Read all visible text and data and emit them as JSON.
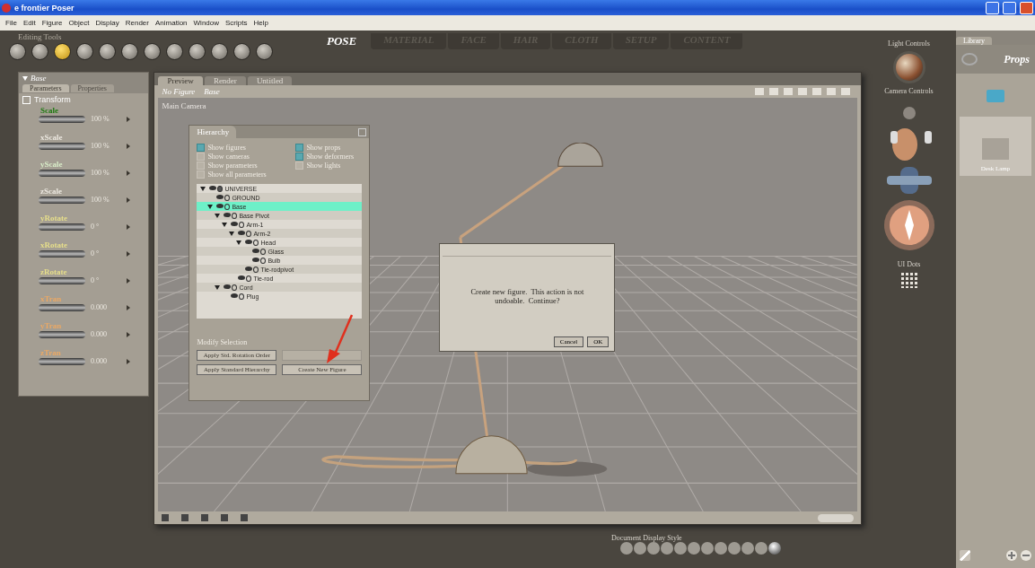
{
  "window": {
    "title": "e frontier Poser"
  },
  "menu": [
    "File",
    "Edit",
    "Figure",
    "Object",
    "Display",
    "Render",
    "Animation",
    "Window",
    "Scripts",
    "Help"
  ],
  "editing_tools": {
    "label": "Editing Tools",
    "tools": [
      {
        "selected": false
      },
      {
        "selected": false
      },
      {
        "selected": true
      },
      {
        "selected": false
      },
      {
        "selected": false
      },
      {
        "selected": false
      },
      {
        "selected": false
      },
      {
        "selected": false
      },
      {
        "selected": false
      },
      {
        "selected": false
      },
      {
        "selected": false
      },
      {
        "selected": false
      }
    ]
  },
  "rooms": [
    {
      "label": "POSE",
      "selected": true
    },
    {
      "label": "MATERIAL",
      "selected": false
    },
    {
      "label": "FACE",
      "selected": false
    },
    {
      "label": "HAIR",
      "selected": false
    },
    {
      "label": "CLOTH",
      "selected": false
    },
    {
      "label": "SETUP",
      "selected": false
    },
    {
      "label": "CONTENT",
      "selected": false
    }
  ],
  "parameters_panel": {
    "title": "Base",
    "tabs": [
      {
        "label": "Parameters",
        "selected": true
      },
      {
        "label": "Properties",
        "selected": false
      }
    ],
    "group": "Transform",
    "params": [
      {
        "name": "Scale",
        "value": "100 %",
        "color": "#1f7a12"
      },
      {
        "name": "xScale",
        "value": "100 %",
        "color": "#ece8e0"
      },
      {
        "name": "yScale",
        "value": "100 %",
        "color": "#d8ecc8"
      },
      {
        "name": "zScale",
        "value": "100 %",
        "color": "#ece8e0"
      },
      {
        "name": "yRotate",
        "value": "0 °",
        "color": "#e6de8a"
      },
      {
        "name": "xRotate",
        "value": "0 °",
        "color": "#e6de8a"
      },
      {
        "name": "zRotate",
        "value": "0 °",
        "color": "#e6de8a"
      },
      {
        "name": "xTran",
        "value": "0.000",
        "color": "#eaa865"
      },
      {
        "name": "yTran",
        "value": "0.000",
        "color": "#eaa865"
      },
      {
        "name": "zTran",
        "value": "0.000",
        "color": "#eaa865"
      }
    ]
  },
  "document": {
    "tabs": [
      {
        "label": "Preview",
        "selected": true
      },
      {
        "label": "Render",
        "selected": false
      },
      {
        "label": "Untitled",
        "selected": false
      }
    ],
    "figure_menu": "No Figure",
    "actor_menu": "Base",
    "camera": "Main Camera"
  },
  "hierarchy": {
    "title": "Hierarchy",
    "options": [
      {
        "label": "Show figures",
        "checked": true
      },
      {
        "label": "Show props",
        "checked": true
      },
      {
        "label": "Show cameras",
        "checked": false
      },
      {
        "label": "Show deformers",
        "checked": true
      },
      {
        "label": "Show parameters",
        "checked": false
      },
      {
        "label": "Show lights",
        "checked": false
      },
      {
        "label": "Show all parameters",
        "checked": false
      }
    ],
    "tree": [
      {
        "label": "UNIVERSE",
        "kind": "universe",
        "expanded": true,
        "selected": false,
        "children": [
          {
            "label": "GROUND",
            "kind": "prop",
            "selected": false
          },
          {
            "label": "Base",
            "kind": "prop",
            "expanded": true,
            "selected": true,
            "children": [
              {
                "label": "Base Pivot",
                "kind": "prop",
                "expanded": true,
                "selected": false,
                "children": [
                  {
                    "label": "Arm-1",
                    "kind": "prop",
                    "expanded": true,
                    "selected": false,
                    "children": [
                      {
                        "label": "Arm-2",
                        "kind": "prop",
                        "expanded": true,
                        "selected": false,
                        "children": [
                          {
                            "label": "Head",
                            "kind": "prop",
                            "expanded": true,
                            "selected": false,
                            "children": [
                              {
                                "label": "Glass",
                                "kind": "prop",
                                "selected": false
                              },
                              {
                                "label": "Bulb",
                                "kind": "prop",
                                "selected": false
                              }
                            ]
                          },
                          {
                            "label": "Tie-rodpivot",
                            "kind": "prop",
                            "selected": false
                          }
                        ]
                      },
                      {
                        "label": "Tie-rod",
                        "kind": "prop",
                        "selected": false
                      }
                    ]
                  }
                ]
              },
              {
                "label": "Cord",
                "kind": "prop",
                "expanded": true,
                "selected": false,
                "children": [
                  {
                    "label": "Plug",
                    "kind": "prop",
                    "selected": false
                  }
                ]
              }
            ]
          }
        ]
      }
    ],
    "section": "Modify Selection",
    "buttons": [
      {
        "label": "Apply Std. Rotation Order",
        "disabled": false
      },
      {
        "disabled": true
      },
      {
        "label": "Apply Standard Hierarchy",
        "disabled": false
      },
      {
        "label": "Create New Figure",
        "disabled": false
      }
    ]
  },
  "confirm_dialog": {
    "message": "Create new figure.  This action is not undoable.  Continue?",
    "buttons": [
      "Cancel",
      "OK"
    ]
  },
  "controls": {
    "light": "Light Controls",
    "camera": "Camera Controls",
    "ui_dots": "UI Dots",
    "display_style": "Document Display Style"
  },
  "library": {
    "tab": "Library",
    "category": "Props",
    "items": [
      "Desk Lamp"
    ]
  }
}
